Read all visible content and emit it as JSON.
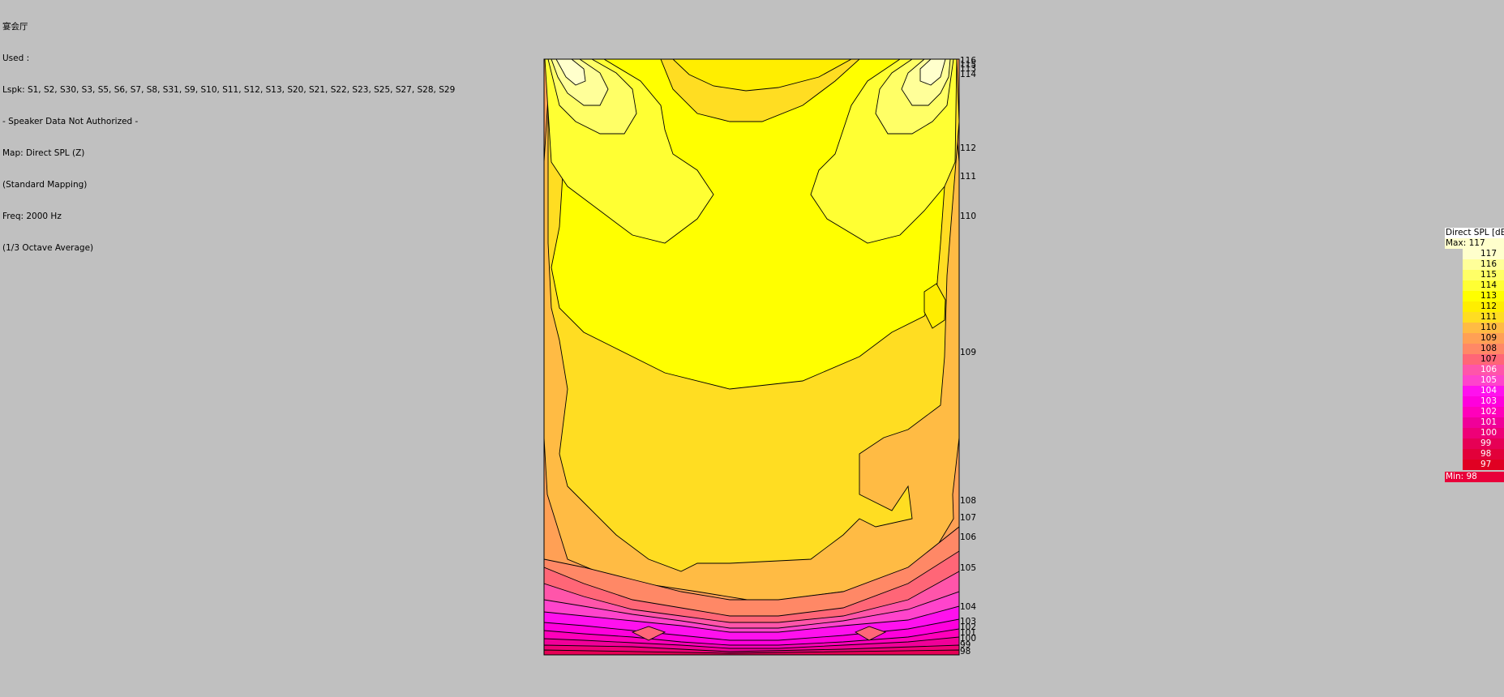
{
  "info": {
    "venue": "宴会厅",
    "used": "Used :",
    "loudspeakers": "Lspk: S1, S2, S30, S3, S5, S6, S7, S8, S31, S9, S10, S11, S12, S13, S20, S21, S22, S23, S25, S27, S28, S29",
    "warning": "- Speaker Data Not Authorized -",
    "map": "Map: Direct SPL (Z)",
    "mapping": "(Standard Mapping)",
    "freq": "Freq: 2000 Hz",
    "averaging": "(1/3 Octave Average)"
  },
  "chart_data": {
    "type": "heatmap",
    "map_title": "Direct SPL [dB]",
    "max_label": "Max:  117",
    "min_label": "Min:  98",
    "max": 117,
    "min": 98,
    "contour_labels": [
      "116",
      "115",
      "113",
      "114",
      "112",
      "111",
      "110",
      "109",
      "108",
      "107",
      "106",
      "105",
      "104",
      "103",
      "102",
      "101",
      "100",
      "99",
      "98"
    ],
    "legend": [
      {
        "value": "117",
        "color": "#ffffcc",
        "text": "#000"
      },
      {
        "value": "116",
        "color": "#ffff99",
        "text": "#000"
      },
      {
        "value": "115",
        "color": "#ffff66",
        "text": "#000"
      },
      {
        "value": "114",
        "color": "#ffff33",
        "text": "#000"
      },
      {
        "value": "113",
        "color": "#ffff00",
        "text": "#000"
      },
      {
        "value": "112",
        "color": "#ffee00",
        "text": "#000"
      },
      {
        "value": "111",
        "color": "#ffdd22",
        "text": "#000"
      },
      {
        "value": "110",
        "color": "#ffbb44",
        "text": "#000"
      },
      {
        "value": "109",
        "color": "#ffa055",
        "text": "#000"
      },
      {
        "value": "108",
        "color": "#ff8866",
        "text": "#000"
      },
      {
        "value": "107",
        "color": "#ff6677",
        "text": "#000"
      },
      {
        "value": "106",
        "color": "#ff55aa",
        "text": "#fff"
      },
      {
        "value": "105",
        "color": "#ff44cc",
        "text": "#fff"
      },
      {
        "value": "104",
        "color": "#ff11ee",
        "text": "#fff"
      },
      {
        "value": "103",
        "color": "#ff00dd",
        "text": "#fff"
      },
      {
        "value": "102",
        "color": "#ff00bb",
        "text": "#fff"
      },
      {
        "value": "101",
        "color": "#f00099",
        "text": "#fff"
      },
      {
        "value": "100",
        "color": "#ee0077",
        "text": "#fff"
      },
      {
        "value": "99",
        "color": "#e60055",
        "text": "#fff"
      },
      {
        "value": "98",
        "color": "#e2003a",
        "text": "#fff"
      },
      {
        "value": "97",
        "color": "#e00022",
        "text": "#fff"
      }
    ]
  }
}
